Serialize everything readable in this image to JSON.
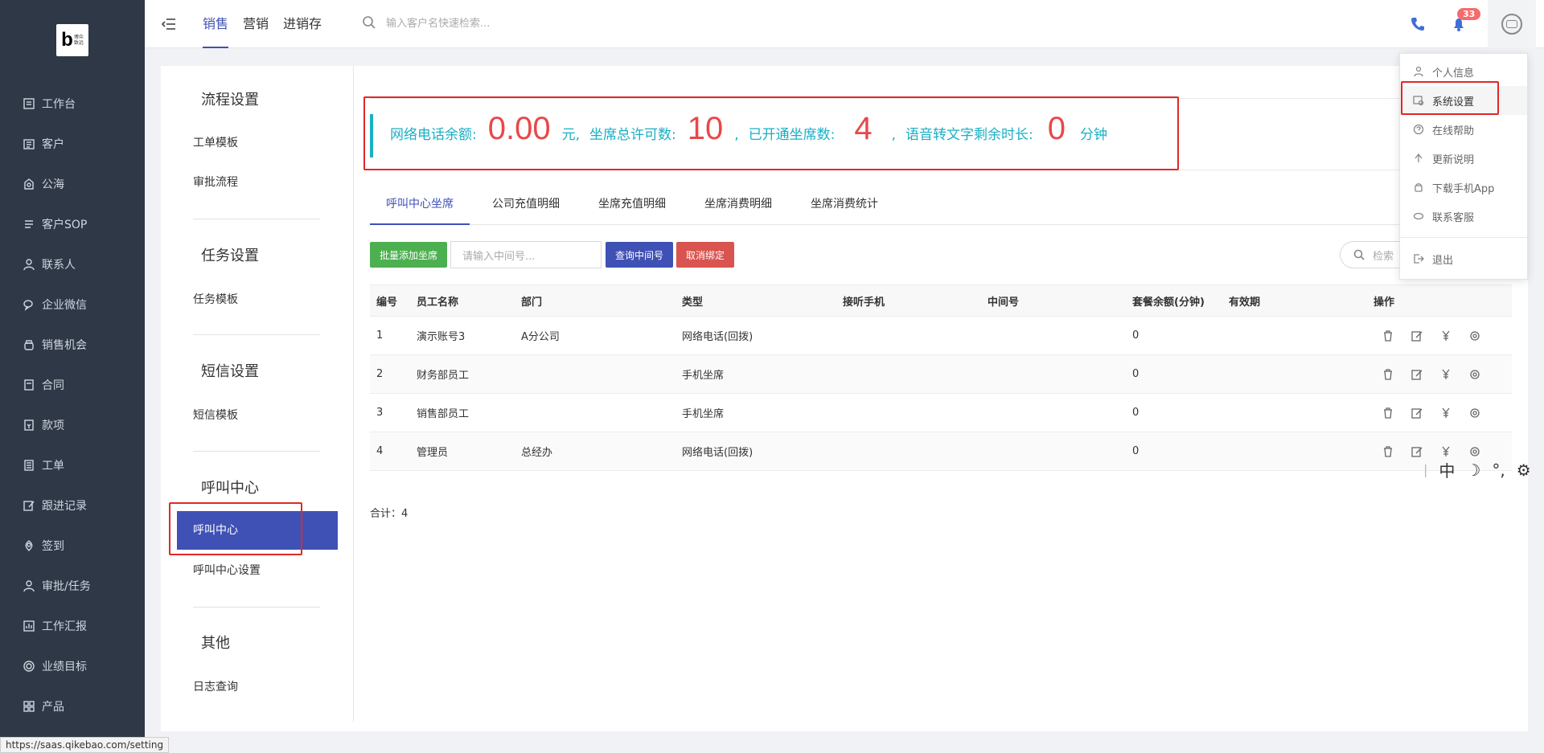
{
  "logo": {
    "letter": "b",
    "text1": "博众",
    "text2": "致远"
  },
  "sidebar": {
    "items": [
      {
        "label": "工作台",
        "icon": "workbench-icon"
      },
      {
        "label": "客户",
        "icon": "customer-icon"
      },
      {
        "label": "公海",
        "icon": "sea-icon"
      },
      {
        "label": "客户SOP",
        "icon": "sop-icon"
      },
      {
        "label": "联系人",
        "icon": "contact-icon"
      },
      {
        "label": "企业微信",
        "icon": "wechat-icon"
      },
      {
        "label": "销售机会",
        "icon": "opportunity-icon"
      },
      {
        "label": "合同",
        "icon": "contract-icon"
      },
      {
        "label": "款项",
        "icon": "payment-icon"
      },
      {
        "label": "工单",
        "icon": "workorder-icon"
      },
      {
        "label": "跟进记录",
        "icon": "followup-icon"
      },
      {
        "label": "签到",
        "icon": "checkin-icon"
      },
      {
        "label": "审批/任务",
        "icon": "approval-icon"
      },
      {
        "label": "工作汇报",
        "icon": "report-icon"
      },
      {
        "label": "业绩目标",
        "icon": "target-icon"
      },
      {
        "label": "产品",
        "icon": "product-icon"
      }
    ]
  },
  "header": {
    "tabs": [
      "销售",
      "营销",
      "进销存"
    ],
    "search_placeholder": "输入客户名快速检索...",
    "badge": "33"
  },
  "settings": {
    "sec1": "流程设置",
    "sec1_links": [
      "工单模板",
      "审批流程"
    ],
    "sec2": "任务设置",
    "sec2_links": [
      "任务模板"
    ],
    "sec3": "短信设置",
    "sec3_links": [
      "短信模板"
    ],
    "sec4": "呼叫中心",
    "sec4_links": [
      "呼叫中心",
      "呼叫中心设置"
    ],
    "sec5": "其他",
    "sec5_links": [
      "日志查询"
    ]
  },
  "stats": {
    "balance_label": "网络电话余额:",
    "balance": "0.00",
    "balance_unit": "元,",
    "seats_label": "坐席总许可数:",
    "seats": "10",
    "sep1": ",",
    "opened_label": "已开通坐席数:",
    "opened": "4",
    "sep2": ",",
    "voice_label": "语音转文字剩余时长:",
    "voice": "0",
    "voice_unit": "分钟"
  },
  "tabs": [
    "呼叫中心坐席",
    "公司充值明细",
    "坐席充值明细",
    "坐席消费明细",
    "坐席消费统计"
  ],
  "actions": {
    "batch_add": "批量添加坐席",
    "input_placeholder": "请输入中间号...",
    "query": "查询中间号",
    "unbind": "取消绑定",
    "search_right": "检索"
  },
  "table": {
    "headers": [
      "编号",
      "员工名称",
      "部门",
      "类型",
      "接听手机",
      "中间号",
      "套餐余额(分钟)",
      "有效期",
      "操作"
    ],
    "rows": [
      [
        "1",
        "演示账号3",
        "A分公司",
        "网络电话(回拨)",
        "",
        "",
        "0",
        ""
      ],
      [
        "2",
        "财务部员工",
        "",
        "手机坐席",
        "",
        "",
        "0",
        ""
      ],
      [
        "3",
        "销售部员工",
        "",
        "手机坐席",
        "",
        "",
        "0",
        ""
      ],
      [
        "4",
        "管理员",
        "总经办",
        "网络电话(回拨)",
        "",
        "",
        "0",
        ""
      ]
    ]
  },
  "total": "合计：4",
  "dropdown": {
    "items": [
      "个人信息",
      "系统设置",
      "在线帮助",
      "更新说明",
      "下载手机App",
      "联系客服",
      "退出"
    ]
  },
  "ime": [
    "中",
    "☽",
    "°,",
    "⚙"
  ],
  "status_url": "https://saas.qikebao.com/setting",
  "colors": {
    "primary": "#3f51b5",
    "sidebar": "#2f3847",
    "accent_cyan": "#1aafc4",
    "number_red": "#e8484a",
    "highlight": "#e02828"
  }
}
